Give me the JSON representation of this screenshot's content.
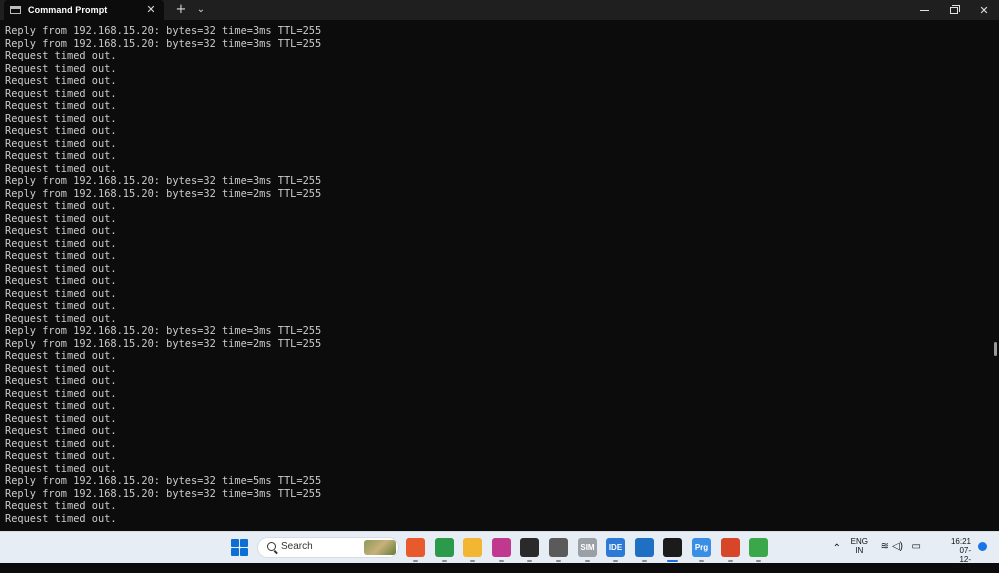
{
  "window": {
    "tab_title": "Command Prompt",
    "tab_close": "✕",
    "new_tab": "+",
    "dropdown": "⌄",
    "minimize": "",
    "maximize": "",
    "close": "✕"
  },
  "terminal": {
    "lines": [
      "Reply from 192.168.15.20: bytes=32 time=3ms TTL=255",
      "Reply from 192.168.15.20: bytes=32 time=3ms TTL=255",
      "Request timed out.",
      "Request timed out.",
      "Request timed out.",
      "Request timed out.",
      "Request timed out.",
      "Request timed out.",
      "Request timed out.",
      "Request timed out.",
      "Request timed out.",
      "Request timed out.",
      "Reply from 192.168.15.20: bytes=32 time=3ms TTL=255",
      "Reply from 192.168.15.20: bytes=32 time=2ms TTL=255",
      "Request timed out.",
      "Request timed out.",
      "Request timed out.",
      "Request timed out.",
      "Request timed out.",
      "Request timed out.",
      "Request timed out.",
      "Request timed out.",
      "Request timed out.",
      "Request timed out.",
      "Reply from 192.168.15.20: bytes=32 time=3ms TTL=255",
      "Reply from 192.168.15.20: bytes=32 time=2ms TTL=255",
      "Request timed out.",
      "Request timed out.",
      "Request timed out.",
      "Request timed out.",
      "Request timed out.",
      "Request timed out.",
      "Request timed out.",
      "Request timed out.",
      "Request timed out.",
      "Request timed out.",
      "Reply from 192.168.15.20: bytes=32 time=5ms TTL=255",
      "Reply from 192.168.15.20: bytes=32 time=3ms TTL=255",
      "Request timed out.",
      "Request timed out."
    ]
  },
  "taskbar": {
    "search_label": "Search",
    "apps": [
      {
        "name": "firefox-icon",
        "color": "#e8592b"
      },
      {
        "name": "chrome-icon",
        "color": "#2b9a4a"
      },
      {
        "name": "file-explorer-icon",
        "color": "#f2b632"
      },
      {
        "name": "wps-office-icon",
        "color": "#c0398f"
      },
      {
        "name": "app-icon",
        "color": "#2a2a2a"
      },
      {
        "name": "app-icon",
        "color": "#5a5a5a"
      },
      {
        "name": "sim-app-icon",
        "color": "#9aa0a6",
        "label": "SIM"
      },
      {
        "name": "ide-icon",
        "color": "#2d7ad6",
        "label": "IDE"
      },
      {
        "name": "app-icon",
        "color": "#1f6fc2"
      },
      {
        "name": "terminal-icon",
        "color": "#1b1b1b"
      },
      {
        "name": "prg-app-icon",
        "color": "#3a8ee6",
        "label": "Prg"
      },
      {
        "name": "app-icon",
        "color": "#d8462a"
      },
      {
        "name": "app-icon",
        "color": "#3aa84a"
      }
    ],
    "tray": {
      "lang_top": "ENG",
      "lang_bottom": "IN",
      "time": "16:21",
      "date": "07-12-2023"
    }
  },
  "colors": {
    "terminal_bg": "#0c0c0c",
    "terminal_text": "#cccccc",
    "taskbar_bg": "#e6edf5",
    "accent": "#1a73e8"
  }
}
